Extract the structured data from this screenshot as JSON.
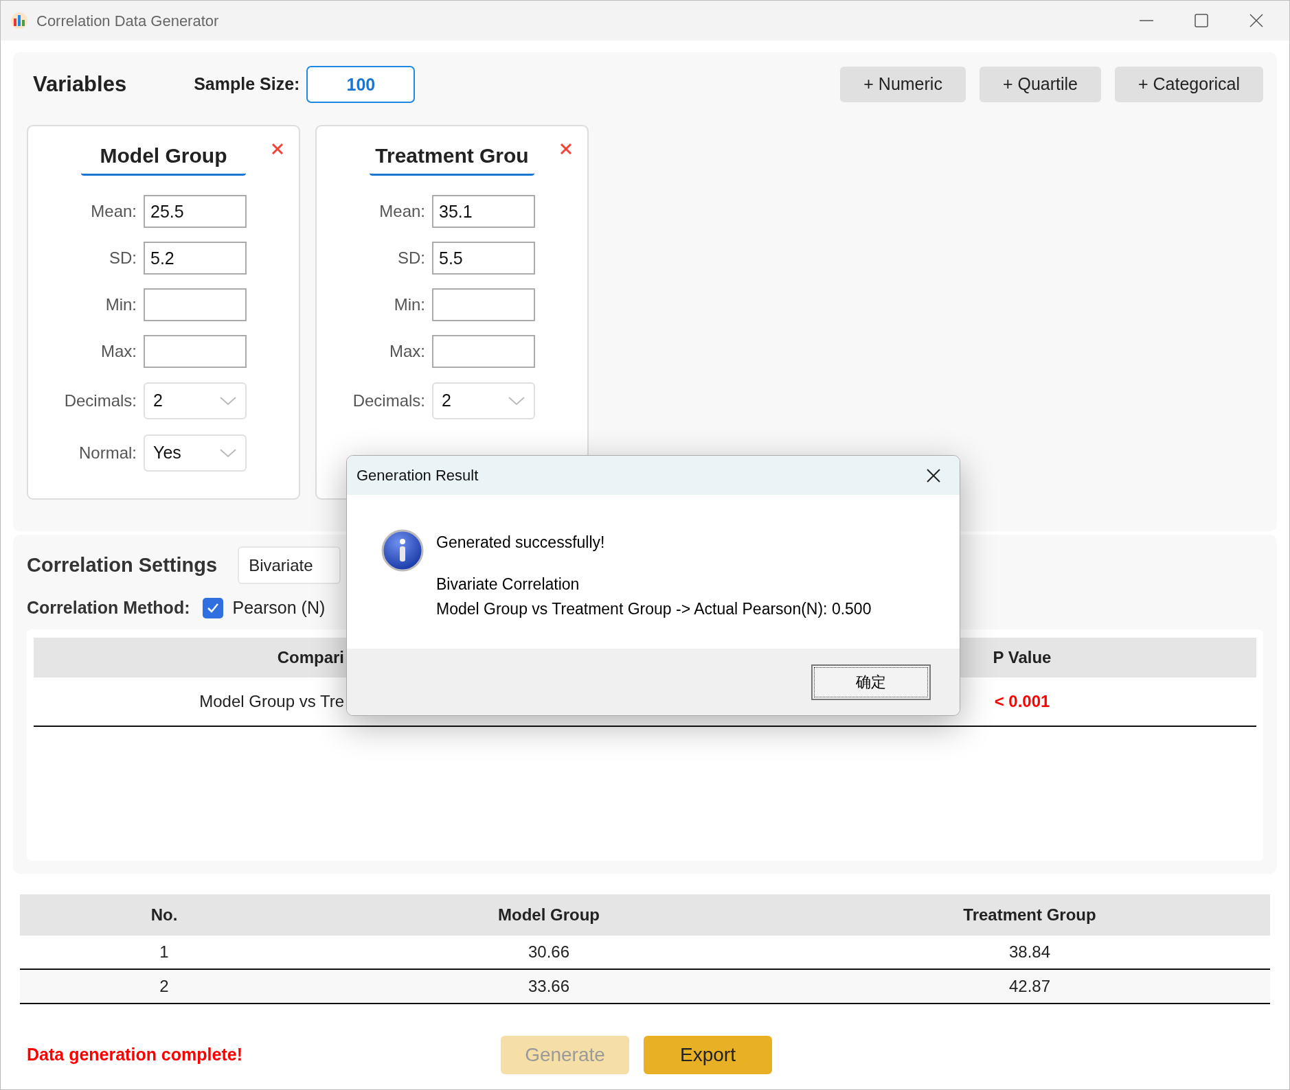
{
  "window": {
    "title": "Correlation Data Generator"
  },
  "variables_panel": {
    "title": "Variables",
    "sample_size_label": "Sample Size:",
    "sample_size": "100",
    "add_buttons": [
      "+ Numeric",
      "+ Quartile",
      "+ Categorical"
    ]
  },
  "variables": [
    {
      "name": "Model Group",
      "fields": [
        {
          "kind": "input",
          "label": "Mean:",
          "value": "25.5"
        },
        {
          "kind": "input",
          "label": "SD:",
          "value": "5.2"
        },
        {
          "kind": "input",
          "label": "Min:"
        },
        {
          "kind": "input",
          "label": "Max:"
        },
        {
          "kind": "select",
          "label": "Decimals:",
          "value": "2"
        },
        {
          "kind": "select",
          "label": "Normal:",
          "value": "Yes"
        }
      ]
    },
    {
      "name": "Treatment Grou",
      "fields": [
        {
          "kind": "input",
          "label": "Mean:",
          "value": "35.1"
        },
        {
          "kind": "input",
          "label": "SD:",
          "value": "5.5"
        },
        {
          "kind": "input",
          "label": "Min:"
        },
        {
          "kind": "input",
          "label": "Max:"
        },
        {
          "kind": "select",
          "label": "Decimals:",
          "value": "2"
        }
      ]
    }
  ],
  "correlation_settings": {
    "title": "Correlation Settings",
    "type_value": "Bivariate",
    "method_label": "Correlation Method:",
    "methods": [
      {
        "label": "Pearson (N)",
        "checked": true
      }
    ],
    "table": {
      "columns": [
        "Compari",
        "P Value"
      ],
      "rows": [
        {
          "comparison": "Model Group vs Tre",
          "p_value": "< 0.001",
          "significant": true
        }
      ]
    }
  },
  "data_table": {
    "columns": [
      "No.",
      "Model Group",
      "Treatment Group"
    ],
    "rows": [
      [
        "1",
        "30.66",
        "38.84"
      ],
      [
        "2",
        "33.66",
        "42.87"
      ]
    ]
  },
  "status": "Data generation complete!",
  "actions": [
    {
      "label": "Generate",
      "disabled": true
    },
    {
      "label": "Export",
      "disabled": false
    }
  ],
  "dialog": {
    "title": "Generation Result",
    "message_title": "Generated successfully!",
    "lines": [
      "Bivariate Correlation",
      "Model Group vs Treatment Group -> Actual Pearson(N): 0.500"
    ],
    "button": "确定"
  }
}
